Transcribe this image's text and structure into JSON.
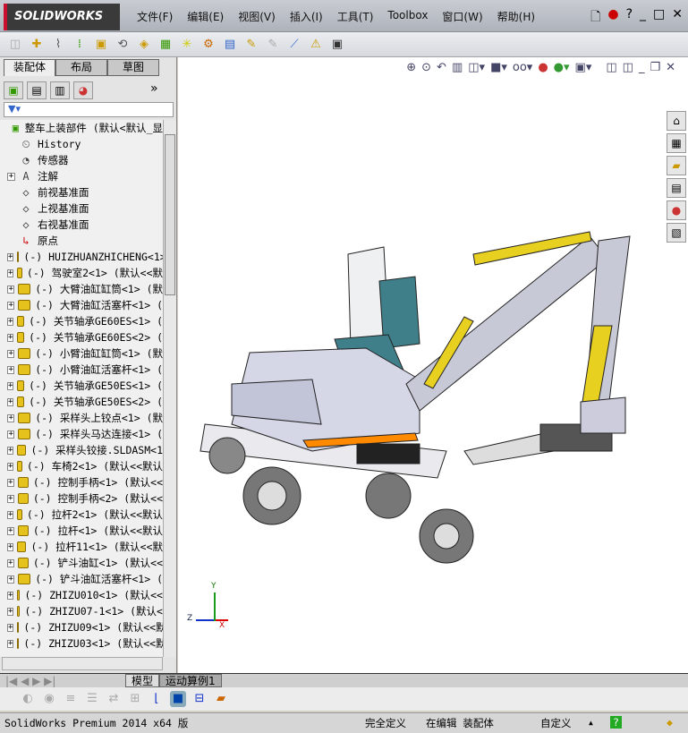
{
  "app": {
    "logo": "SOLIDWORKS"
  },
  "menu": [
    "文件(F)",
    "编辑(E)",
    "视图(V)",
    "插入(I)",
    "工具(T)",
    "Toolbox",
    "窗口(W)",
    "帮助(H)"
  ],
  "panel": {
    "tabs": [
      "装配体",
      "布局",
      "草图"
    ],
    "filter_icon": "filter-icon"
  },
  "tree": {
    "root": "整车上装部件  (默认<默认_显",
    "items": [
      {
        "label": "History",
        "icon": "history-icon",
        "exp": false
      },
      {
        "label": "传感器",
        "icon": "sensor-icon",
        "exp": false
      },
      {
        "label": "注解",
        "icon": "annotation-icon",
        "exp": true
      },
      {
        "label": "前视基准面",
        "icon": "plane-icon",
        "exp": false
      },
      {
        "label": "上视基准面",
        "icon": "plane-icon",
        "exp": false
      },
      {
        "label": "右视基准面",
        "icon": "plane-icon",
        "exp": false
      },
      {
        "label": "原点",
        "icon": "origin-icon",
        "exp": false
      },
      {
        "label": "(-) HUIZHUANZHICHENG<1>",
        "icon": "part-icon",
        "exp": true
      },
      {
        "label": "(-) 驾驶室2<1> (默认<<默",
        "icon": "part-icon",
        "exp": true
      },
      {
        "label": "(-) 大臂油缸缸筒<1> (默",
        "icon": "part-icon",
        "exp": true
      },
      {
        "label": "(-) 大臂油缸活塞杆<1> (",
        "icon": "part-icon",
        "exp": true
      },
      {
        "label": "(-) 关节轴承GE60ES<1> (",
        "icon": "part-icon",
        "exp": true
      },
      {
        "label": "(-) 关节轴承GE60ES<2> (",
        "icon": "part-icon",
        "exp": true
      },
      {
        "label": "(-) 小臂油缸缸筒<1> (默",
        "icon": "part-icon",
        "exp": true
      },
      {
        "label": "(-) 小臂油缸活塞杆<1> (",
        "icon": "part-icon",
        "exp": true
      },
      {
        "label": "(-) 关节轴承GE50ES<1> (",
        "icon": "part-icon",
        "exp": true
      },
      {
        "label": "(-) 关节轴承GE50ES<2> (",
        "icon": "part-icon",
        "exp": true
      },
      {
        "label": "(-) 采样头上铰点<1> (默",
        "icon": "part-icon",
        "exp": true
      },
      {
        "label": "(-) 采样头马达连接<1> (",
        "icon": "part-icon",
        "exp": true
      },
      {
        "label": "(-) 采样头铰接.SLDASM<1",
        "icon": "part-icon",
        "exp": true
      },
      {
        "label": "(-) 车椅2<1> (默认<<默认",
        "icon": "part-icon",
        "exp": true
      },
      {
        "label": "(-) 控制手柄<1> (默认<<",
        "icon": "part-icon",
        "exp": true
      },
      {
        "label": "(-) 控制手柄<2> (默认<<",
        "icon": "part-icon",
        "exp": true
      },
      {
        "label": "(-) 拉杆2<1> (默认<<默认",
        "icon": "part-icon",
        "exp": true
      },
      {
        "label": "(-) 拉杆<1> (默认<<默认",
        "icon": "part-icon",
        "exp": true
      },
      {
        "label": "(-) 拉杆11<1> (默认<<默",
        "icon": "part-icon",
        "exp": true
      },
      {
        "label": "(-) 铲斗油缸<1> (默认<<",
        "icon": "part-icon",
        "exp": true
      },
      {
        "label": "(-) 铲斗油缸活塞杆<1> (",
        "icon": "part-icon",
        "exp": true
      },
      {
        "label": "(-) ZHIZU010<1> (默认<<",
        "icon": "part-icon",
        "exp": true
      },
      {
        "label": "(-) ZHIZU07-1<1> (默认<",
        "icon": "part-icon",
        "exp": true
      },
      {
        "label": "(-) ZHIZU09<1> (默认<<默",
        "icon": "part-icon",
        "exp": true
      },
      {
        "label": "(-) ZHIZU03<1> (默认<<默",
        "icon": "part-icon",
        "exp": true
      }
    ]
  },
  "axes": {
    "x": "X",
    "y": "Y",
    "z": "Z"
  },
  "bottom_tabs": [
    "模型",
    "运动算例1"
  ],
  "status": {
    "product": "SolidWorks Premium 2014 x64 版",
    "defined": "完全定义",
    "editing": "在编辑 装配体",
    "units": "自定义"
  },
  "colors": {
    "viewport_bg": "#ffffff",
    "boom": "#c7c9d6",
    "cylinder": "#e8d020",
    "cab_glass": "#3e7f8a"
  }
}
